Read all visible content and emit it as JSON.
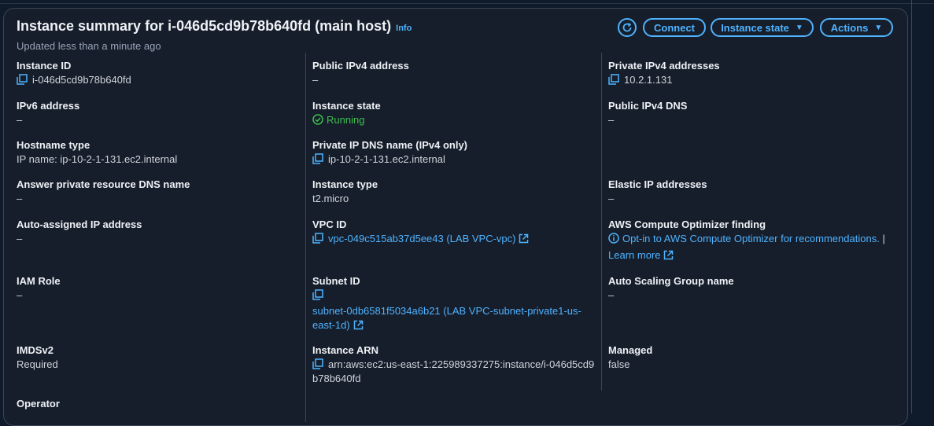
{
  "header": {
    "title": "Instance summary for i-046d5cd9b78b640fd (main host)",
    "info": "Info",
    "subtitle": "Updated less than a minute ago",
    "buttons": {
      "connect": "Connect",
      "instance_state": "Instance state",
      "actions": "Actions"
    }
  },
  "fields": {
    "instance_id": {
      "label": "Instance ID",
      "value": "i-046d5cd9b78b640fd"
    },
    "public_ipv4": {
      "label": "Public IPv4 address",
      "value": "–"
    },
    "private_ipv4": {
      "label": "Private IPv4 addresses",
      "value": "10.2.1.131"
    },
    "ipv6": {
      "label": "IPv6 address",
      "value": "–"
    },
    "instance_state": {
      "label": "Instance state",
      "value": "Running"
    },
    "public_dns": {
      "label": "Public IPv4 DNS",
      "value": "–"
    },
    "hostname_type": {
      "label": "Hostname type",
      "value": "IP name: ip-10-2-1-131.ec2.internal"
    },
    "private_dns": {
      "label": "Private IP DNS name (IPv4 only)",
      "value": "ip-10-2-1-131.ec2.internal"
    },
    "answer_dns": {
      "label": "Answer private resource DNS name",
      "value": "–"
    },
    "instance_type": {
      "label": "Instance type",
      "value": "t2.micro"
    },
    "elastic_ip": {
      "label": "Elastic IP addresses",
      "value": "–"
    },
    "auto_ip": {
      "label": "Auto-assigned IP address",
      "value": "–"
    },
    "vpc_id": {
      "label": "VPC ID",
      "value": "vpc-049c515ab37d5ee43 (LAB VPC-vpc)"
    },
    "optimizer": {
      "label": "AWS Compute Optimizer finding",
      "value": "Opt-in to AWS Compute Optimizer for recommendations.",
      "separator": "|",
      "learn_more": "Learn more"
    },
    "iam_role": {
      "label": "IAM Role",
      "value": "–"
    },
    "subnet_id": {
      "label": "Subnet ID",
      "value_line1": "subnet-0db6581f5034a6b21 (LAB VPC-subnet-private1-us-",
      "value_line2": "east-1d)"
    },
    "asg_name": {
      "label": "Auto Scaling Group name",
      "value": "–"
    },
    "imdsv2": {
      "label": "IMDSv2",
      "value": "Required"
    },
    "instance_arn": {
      "label": "Instance ARN",
      "value_line1": "arn:aws:ec2:us-east-1:225989337275:instance/i-046d5cd9",
      "value_line2": "b78b640fd"
    },
    "managed": {
      "label": "Managed",
      "value": "false"
    },
    "operator": {
      "label": "Operator"
    }
  },
  "colors": {
    "accent": "#4fb3ff",
    "running": "#3fbf4f",
    "panel": "#161e2b",
    "background": "#0f1b2a"
  }
}
